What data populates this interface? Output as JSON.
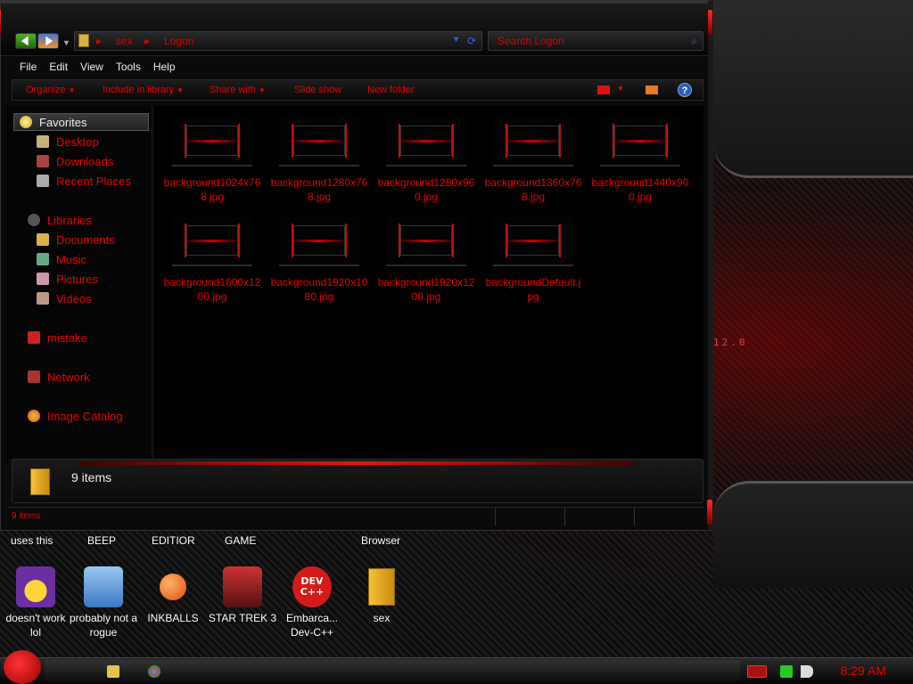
{
  "window": {
    "address": {
      "segments": [
        "sex",
        "Logon"
      ]
    },
    "search_placeholder": "Search Logon",
    "menu": [
      "File",
      "Edit",
      "View",
      "Tools",
      "Help"
    ],
    "commands": {
      "organize": "Organize",
      "include_library": "Include in library",
      "share_with": "Share with",
      "slide_show": "Slide show",
      "new_folder": "New folder",
      "help": "?"
    },
    "nav": {
      "favorites": "Favorites",
      "desktop": "Desktop",
      "downloads": "Downloads",
      "recent": "Recent Places",
      "libraries": "Libraries",
      "documents": "Documents",
      "music": "Music",
      "pictures": "Pictures",
      "videos": "Videos",
      "mistake": "mistake",
      "network": "Network",
      "image_catalog": "Image Catalog"
    },
    "files": [
      {
        "name": "background1024x768.jpg"
      },
      {
        "name": "background1280x768.jpg"
      },
      {
        "name": "background1280x960.jpg"
      },
      {
        "name": "background1360x768.jpg"
      },
      {
        "name": "background1440x900.jpg"
      },
      {
        "name": "background1600x1200.jpg"
      },
      {
        "name": "background1920x1080.jpg"
      },
      {
        "name": "background1920x1200.jpg"
      },
      {
        "name": "backgroundDefault.jpg"
      }
    ],
    "details_count": "9 items",
    "status_count": "9 items"
  },
  "desktop": {
    "top_labels": [
      "uses this",
      "BEEP",
      "EDITIOR",
      "GAME",
      "Browser"
    ],
    "icons": [
      {
        "label": "doesn't work lol"
      },
      {
        "label": "probably not a rogue"
      },
      {
        "label": "INKBALLS"
      },
      {
        "label": "STAR TREK 3"
      },
      {
        "label": "Embarca... Dev-C++"
      },
      {
        "label": "sex"
      }
    ],
    "dev_icon_text": "DEV C++",
    "deco_text": [
      "12.0"
    ]
  },
  "taskbar": {
    "clock": "8:29 AM"
  },
  "colors": {
    "accent": "#dd0000",
    "background": "#0a0a0a"
  }
}
